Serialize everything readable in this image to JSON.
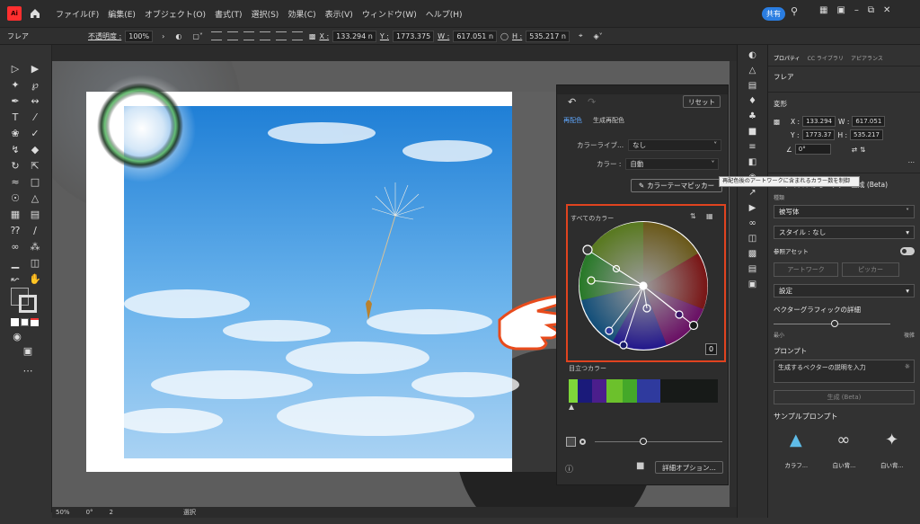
{
  "menubar": {
    "app_logo": "Ai",
    "menus": [
      "ファイル(F)",
      "編集(E)",
      "オブジェクト(O)",
      "書式(T)",
      "選択(S)",
      "効果(C)",
      "表示(V)",
      "ウィンドウ(W)",
      "ヘルプ(H)"
    ],
    "share_label": "共有"
  },
  "control_bar": {
    "selection_label": "フレア",
    "opacity_label": "不透明度 :",
    "opacity_value": "100%",
    "x_label": "X :",
    "x_value": "133.294 n",
    "y_label": "Y :",
    "y_value": "1773.375",
    "w_label": "W :",
    "w_value": "617.051 n",
    "h_label": "H :",
    "h_value": "535.217 n"
  },
  "recolor": {
    "reset_label": "リセット",
    "tab_recolor": "再配色",
    "tab_generative": "生成再配色",
    "library_label": "カラーライブ...",
    "library_value": "なし",
    "colors_label": "カラー :",
    "colors_value": "自動",
    "theme_picker_label": "カラーテーマピッカー",
    "tooltip": "再配色後のアートワークに含まれるカラー数を制御",
    "all_colors_label": "すべてのカラー",
    "badge": "0",
    "prominent_label": "目立つカラー",
    "prominent_colors": [
      "#7ed63a",
      "#1a1a7a",
      "#4b1e8c",
      "#6cc12c",
      "#44a829",
      "#2f3a9e",
      "#171a18",
      "#171a18"
    ],
    "detail_options_label": "詳細オプション..."
  },
  "properties": {
    "tabs": [
      "プロパティ",
      "CC ライブラリ",
      "アピアランス"
    ],
    "selection_name": "フレア",
    "transform_title": "変形",
    "x_label": "X :",
    "x_value": "133.294",
    "y_label": "Y :",
    "y_value": "1773.37",
    "w_label": "W :",
    "w_value": "617.051",
    "h_label": "H :",
    "h_value": "535.217",
    "angle_value": "0°",
    "text_to_vector_title": "テキストからベクター生成 (Beta)",
    "type_label": "種類",
    "type_value": "被写体",
    "style_label": "スタイル : なし",
    "ref_asset_label": "参照アセット",
    "artwork_btn": "アートワーク",
    "picker_btn": "ピッカー",
    "settings_label": "設定",
    "vector_detail_label": "ベクターグラフィックの詳細",
    "slider_min": "最小",
    "slider_max": "複雑",
    "prompt_title": "プロンプト",
    "prompt_placeholder": "生成するベクターの説明を入力",
    "generate_btn": "生成 (Beta)",
    "samples_title": "サンプルプロンプト",
    "sample_labels": [
      "カラフ...",
      "白い背...",
      "白い背..."
    ]
  },
  "status": {
    "zoom": "50%",
    "rotation": "0°",
    "artboard": "2",
    "mode": "選択"
  }
}
